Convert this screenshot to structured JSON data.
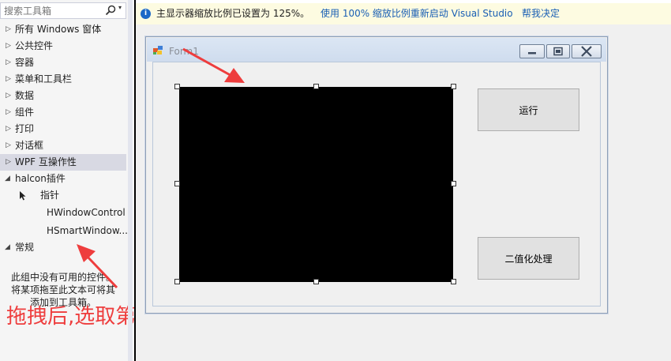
{
  "toolbox": {
    "search_placeholder": "搜索工具箱",
    "groups": [
      {
        "label": "所有 Windows 窗体"
      },
      {
        "label": "公共控件"
      },
      {
        "label": "容器"
      },
      {
        "label": "菜单和工具栏"
      },
      {
        "label": "数据"
      },
      {
        "label": "组件"
      },
      {
        "label": "打印"
      },
      {
        "label": "对话框"
      },
      {
        "label": "WPF 互操作性"
      },
      {
        "label": "halcon插件"
      },
      {
        "label": "常规"
      }
    ],
    "halcon_items": [
      {
        "label": "指针",
        "icon": "pointer-icon"
      },
      {
        "label": "HWindowControl"
      },
      {
        "label": "HSmartWindow..."
      }
    ],
    "empty_hint": [
      "此组中没有可用的控件。",
      "将某项拖至此文本可将其",
      "添加到工具箱。"
    ]
  },
  "annotation": "拖拽后,选取第二个",
  "infobar": {
    "message": "主显示器缩放比例已设置为 125%。",
    "link_restart": "使用 100% 缩放比例重新启动 Visual Studio",
    "link_help": "帮我决定"
  },
  "form": {
    "title": "Form1",
    "run_button": "运行",
    "binarize_button": "二值化处理"
  },
  "colors": {
    "annotation": "#ee3d3d",
    "info_bar": "#fdfbe1",
    "link": "#1a5fb4",
    "selection": "#d8d9e3"
  }
}
